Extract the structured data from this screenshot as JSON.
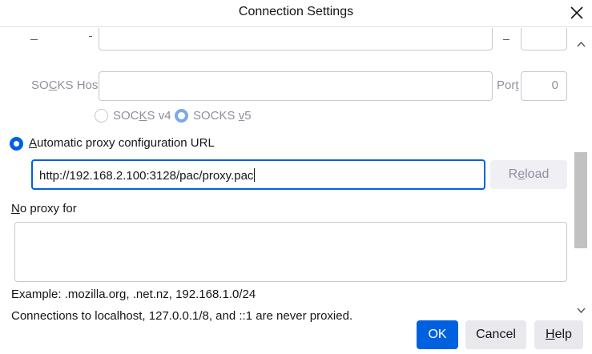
{
  "window": {
    "title": "Connection Settings",
    "close_icon": "close-icon"
  },
  "socks": {
    "host_label": "SOCKS Host",
    "port_label": "Port",
    "port_value": "0",
    "v4_label": "SOCKS v4",
    "v5_label": "SOCKS v5",
    "selected_version": "SOCKS v5"
  },
  "auto_proxy": {
    "label": "Automatic proxy configuration URL",
    "selected": true,
    "url_value": "http://192.168.2.100:3128/pac/proxy.pac",
    "reload_label": "Reload"
  },
  "no_proxy": {
    "label": "No proxy for",
    "value": "",
    "example": "Example: .mozilla.org, .net.nz, 192.168.1.0/24",
    "note": "Connections to localhost, 127.0.0.1/8, and ::1 are never proxied."
  },
  "buttons": {
    "ok": "OK",
    "cancel": "Cancel",
    "help": "Help"
  },
  "colors": {
    "accent": "#0061e0",
    "muted_text": "#8f8f9d"
  }
}
